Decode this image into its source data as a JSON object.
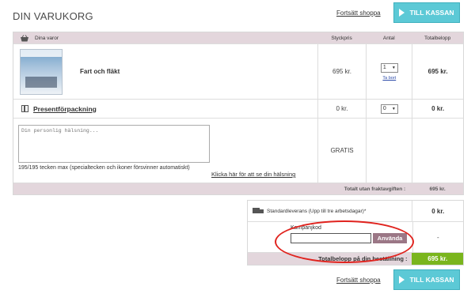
{
  "header": {
    "title": "DIN VARUKORG",
    "continue_link": "Fortsätt shoppa",
    "checkout_label": "TILL KASSAN"
  },
  "table": {
    "columns": {
      "items": "Dina varor",
      "unit_price": "Styckpris",
      "quantity": "Antal",
      "total": "Totalbelopp"
    },
    "product": {
      "name": "Fart och fläkt",
      "unit_price": "695 kr.",
      "quantity": "1",
      "remove_link": "Ta bort",
      "total": "695 kr."
    },
    "gift_wrap": {
      "label": "Presentförpackning",
      "unit_price": "0 kr.",
      "quantity": "0",
      "total": "0 kr."
    },
    "message": {
      "placeholder": "Din personlig hälsning...",
      "counter": "195/195 tecken max (specialtecken och ikoner försvinner automatiskt)",
      "see_link": "Klicka här för att se din hälsning",
      "price": "GRATIS"
    },
    "subtotal": {
      "label": "Totalt utan fraktavgiften :",
      "value": "695 kr."
    }
  },
  "shipping": {
    "option": "Standardleverans (Upp till tre arbetsdagar)*",
    "option_price": "0 kr.",
    "promo_label": "Kampanjkod",
    "promo_value": "",
    "apply_label": "Använda",
    "promo_discount": "-",
    "grand_label": "Totalbelopp på din beställning :",
    "grand_value": "695 kr."
  },
  "colors": {
    "accent": "#5cc9d6",
    "header_bg": "#e3d6dc",
    "total_green": "#7ab51d",
    "highlight_ring": "#e0231e"
  },
  "icons": [
    "basket-icon",
    "gift-icon",
    "truck-icon",
    "play-icon"
  ]
}
